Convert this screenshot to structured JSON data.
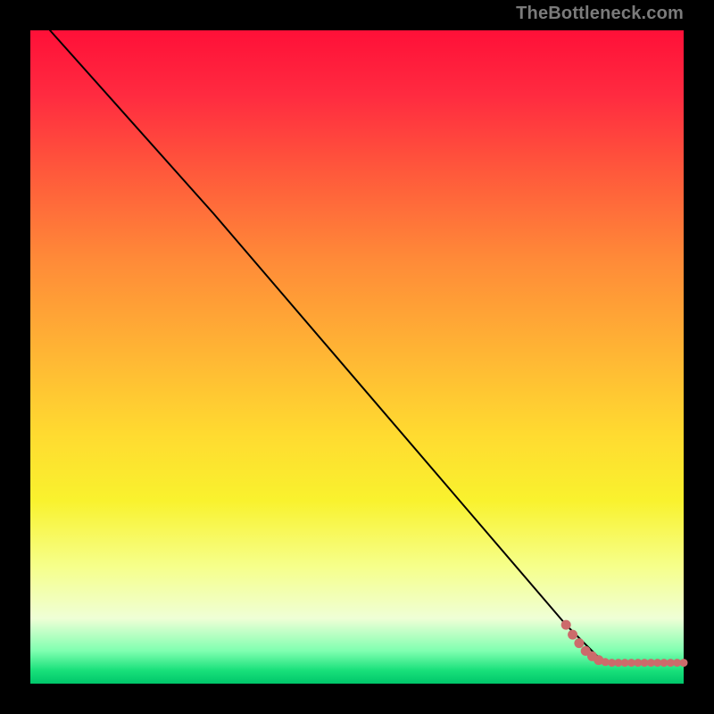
{
  "watermark": "TheBottleneck.com",
  "chart_data": {
    "type": "line",
    "title": "",
    "xlabel": "",
    "ylabel": "",
    "xlim": [
      0,
      100
    ],
    "ylim": [
      0,
      100
    ],
    "series": [
      {
        "name": "curve",
        "color": "#000000",
        "points": [
          {
            "x": 3,
            "y": 100
          },
          {
            "x": 28,
            "y": 72
          },
          {
            "x": 82,
            "y": 9
          },
          {
            "x": 87,
            "y": 4
          }
        ]
      },
      {
        "name": "markers",
        "color": "#cc6b6b",
        "points": [
          {
            "x": 82,
            "y": 9.0
          },
          {
            "x": 83,
            "y": 7.5
          },
          {
            "x": 84,
            "y": 6.2
          },
          {
            "x": 85,
            "y": 5.0
          },
          {
            "x": 86,
            "y": 4.2
          },
          {
            "x": 87,
            "y": 3.6
          },
          {
            "x": 88,
            "y": 3.3
          },
          {
            "x": 89,
            "y": 3.2
          },
          {
            "x": 90,
            "y": 3.2
          },
          {
            "x": 91,
            "y": 3.2
          },
          {
            "x": 92,
            "y": 3.2
          },
          {
            "x": 93,
            "y": 3.2
          },
          {
            "x": 94,
            "y": 3.2
          },
          {
            "x": 95,
            "y": 3.2
          },
          {
            "x": 96,
            "y": 3.2
          },
          {
            "x": 97,
            "y": 3.2
          },
          {
            "x": 98,
            "y": 3.2
          },
          {
            "x": 99,
            "y": 3.2
          },
          {
            "x": 100,
            "y": 3.2
          }
        ]
      }
    ]
  }
}
